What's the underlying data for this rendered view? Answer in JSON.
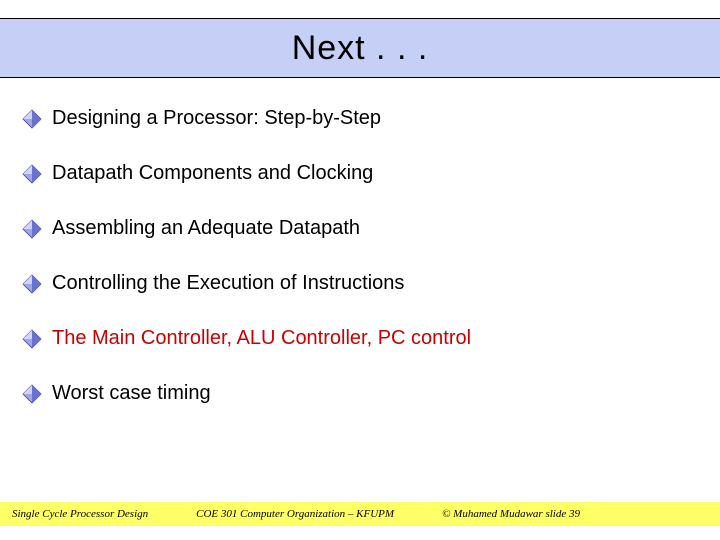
{
  "title": "Next . . .",
  "bullets": [
    {
      "text": "Designing a Processor: Step-by-Step",
      "highlight": false
    },
    {
      "text": "Datapath Components and Clocking",
      "highlight": false
    },
    {
      "text": "Assembling an Adequate Datapath",
      "highlight": false
    },
    {
      "text": "Controlling the Execution of Instructions",
      "highlight": false
    },
    {
      "text": "The Main Controller, ALU Controller, PC control",
      "highlight": true
    },
    {
      "text": "Worst case timing",
      "highlight": false
    }
  ],
  "footer": {
    "left": "Single Cycle Processor Design",
    "center": "COE 301 Computer Organization – KFUPM",
    "right": "© Muhamed Mudawar  slide 39"
  },
  "colors": {
    "title_band": "#c6cff6",
    "highlight_text": "#cc0000",
    "footer_bg": "#ffff66"
  }
}
